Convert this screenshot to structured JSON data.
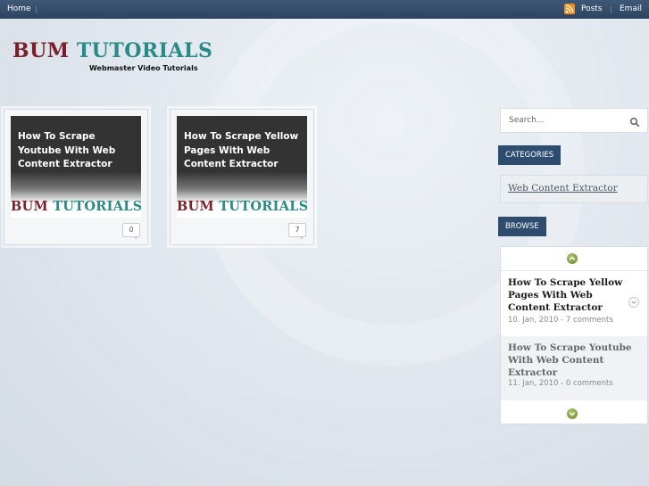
{
  "nav": {
    "home": "Home",
    "separator": "|",
    "posts": "Posts",
    "email": "Email"
  },
  "logo": {
    "word1": "BUM",
    "word2": "TUTORIALS",
    "tagline": "Webmaster Video Tutorials"
  },
  "posts": [
    {
      "title": "How To Scrape Youtube With Web Content Extractor",
      "brand_word1": "BUM",
      "brand_word2": "TUTORIALS",
      "comments": "0"
    },
    {
      "title": "How To Scrape Yellow Pages With Web Content Extractor",
      "brand_word1": "BUM",
      "brand_word2": "TUTORIALS",
      "comments": "7"
    }
  ],
  "sidebar": {
    "search_placeholder": "Search...",
    "categories_label": "CATEGORIES",
    "categories": [
      "Web Content Extractor"
    ],
    "browse_label": "BROWSE",
    "browse_items": [
      {
        "title": "How To Scrape Yellow Pages With Web Content Extractor",
        "meta": "10. Jan, 2010 - 7 comments"
      },
      {
        "title": "How To Scrape Youtube With Web Content Extractor",
        "meta": "11. Jan, 2010 - 0 comments"
      }
    ]
  },
  "colors": {
    "topbar": "#34506f",
    "brand_red": "#7a1f2a",
    "brand_teal": "#2a8a88",
    "sidebar_heading": "#2e4d6e",
    "arrow_green": "#8aa84a",
    "rss_orange": "#f28d1e"
  },
  "icons": {
    "rss": "rss-icon",
    "search": "search-icon",
    "scroll_up": "arrow-up-icon",
    "scroll_down": "arrow-down-icon",
    "item_chevron": "chevron-down-icon",
    "comment_bubble": "comment-bubble-icon"
  }
}
